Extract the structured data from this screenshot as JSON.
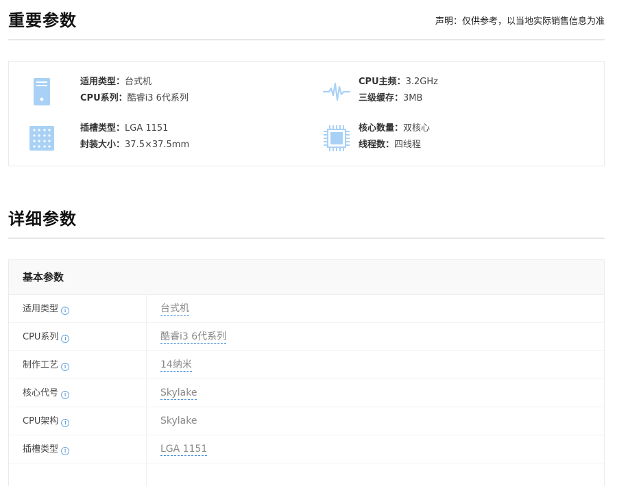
{
  "important": {
    "title": "重要参数",
    "disclaimer": "声明：仅供参考，以当地实际销售信息为准",
    "items": [
      {
        "icon": "desktop-tower-icon",
        "lines": [
          {
            "label": "适用类型：",
            "value": "台式机"
          },
          {
            "label": "CPU系列：",
            "value": "酷睿i3 6代系列"
          }
        ]
      },
      {
        "icon": "frequency-wave-icon",
        "lines": [
          {
            "label": "CPU主频：",
            "value": "3.2GHz"
          },
          {
            "label": "三级缓存：",
            "value": "3MB"
          }
        ]
      },
      {
        "icon": "socket-grid-icon",
        "lines": [
          {
            "label": "插槽类型：",
            "value": "LGA 1151"
          },
          {
            "label": "封装大小：",
            "value": "37.5×37.5mm"
          }
        ]
      },
      {
        "icon": "cpu-chip-icon",
        "lines": [
          {
            "label": "核心数量：",
            "value": "双核心"
          },
          {
            "label": "线程数：",
            "value": "四线程"
          }
        ]
      }
    ]
  },
  "detail": {
    "title": "详细参数",
    "group_title": "基本参数",
    "info_glyph": "i",
    "rows": [
      {
        "key": "适用类型",
        "value": "台式机"
      },
      {
        "key": "CPU系列",
        "value": "酷睿i3 6代系列"
      },
      {
        "key": "制作工艺",
        "value": "14纳米"
      },
      {
        "key": "核心代号",
        "value": "Skylake"
      },
      {
        "key": "CPU架构",
        "value": "Skylake"
      },
      {
        "key": "插槽类型",
        "value": "LGA 1151"
      }
    ]
  },
  "colors": {
    "icon_blue": "#a9d1f5",
    "link_blue": "#4a90d9"
  }
}
